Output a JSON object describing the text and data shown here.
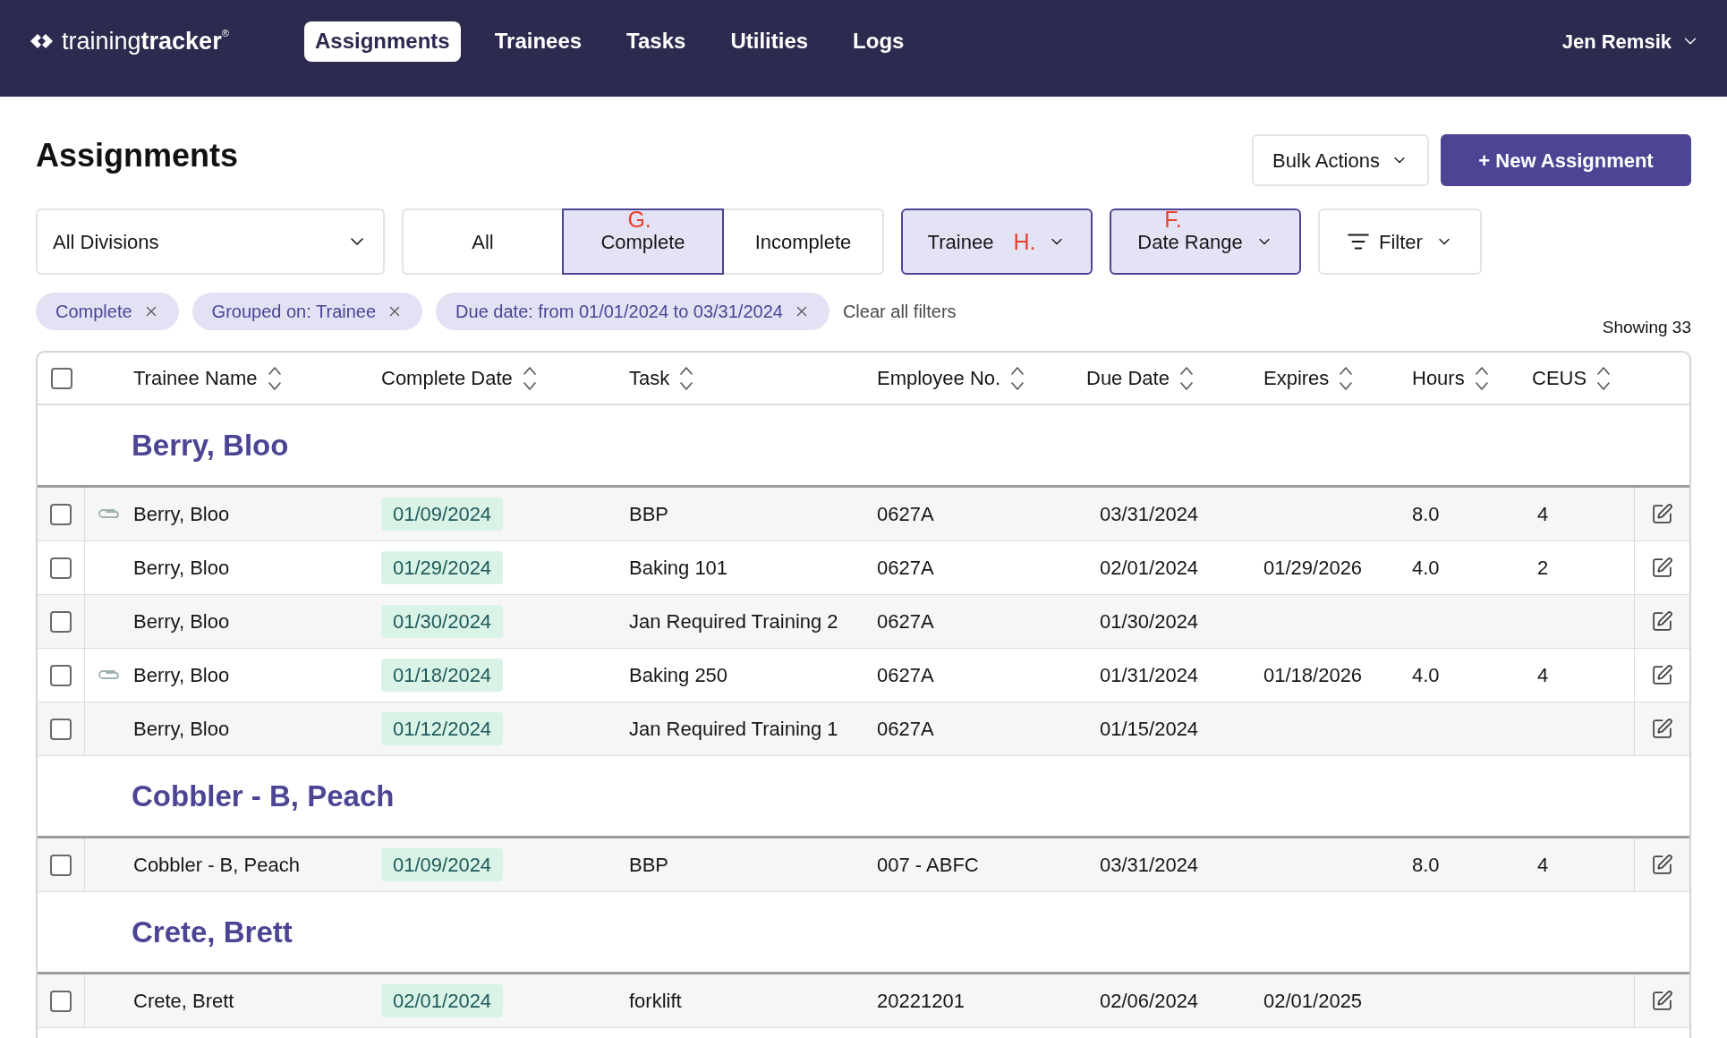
{
  "nav": {
    "logo": "training**tracker**$^{®}$",
    "tabs": [
      {
        "label": "Assignments",
        "selected": true
      },
      {
        "label": "Trainees",
        "selected": false
      },
      {
        "label": "Tasks",
        "selected": false
      },
      {
        "label": "Utilities",
        "selected": false
      },
      {
        "label": "Logs",
        "selected": false
      }
    ],
    "user": "Jen Remsik"
  },
  "header": {
    "title": "Assignments",
    "bulk_actions": "Bulk Actions",
    "new_button": "+ New Assignment"
  },
  "filters": {
    "division": {
      "value": "All Divisions"
    },
    "status_tabs": [
      {
        "label": "All",
        "selected": false
      },
      {
        "label": "Complete",
        "selected": true,
        "annotation": {
          "kind": "above",
          "text": "G."
        }
      },
      {
        "label": "Incomplete",
        "selected": false
      }
    ],
    "dropdowns": [
      {
        "kind": "dropdown",
        "label": "Trainee",
        "active": true,
        "annotation": {
          "kind": "inline",
          "text": "H."
        }
      },
      {
        "kind": "dropdown",
        "label": "Date Range",
        "active": true,
        "annotation": {
          "kind": "above",
          "text": "F."
        }
      },
      {
        "kind": "filter",
        "label": "Filter",
        "active": false
      }
    ]
  },
  "chips": [
    {
      "label": "Complete"
    },
    {
      "label": "Grouped on: Trainee"
    },
    {
      "label": "Due date: from 01/01/2024 to 03/31/2024"
    }
  ],
  "clear_filters": "Clear all filters",
  "showing": "Showing 33",
  "table": {
    "select_all": {
      "checked": false
    },
    "columns": [
      "Trainee Name",
      "Complete Date",
      "Task",
      "Employee No.",
      "Due Date",
      "Expires",
      "Hours",
      "CEUS"
    ],
    "groups": [
      {
        "name": "Berry, Bloo",
        "rows": [
          {
            "checked": false,
            "attachment": true,
            "trainee": "Berry, Bloo",
            "complete_date": "01/09/2024",
            "task": "BBP",
            "employee_no": "0627A",
            "due_date": "03/31/2024",
            "hours": "8.0",
            "ceus": "4"
          },
          {
            "checked": false,
            "attachment": false,
            "trainee": "Berry, Bloo",
            "complete_date": "01/29/2024",
            "task": "Baking 101",
            "employee_no": "0627A",
            "due_date": "02/01/2024",
            "expires": "01/29/2026",
            "hours": "4.0",
            "ceus": "2"
          },
          {
            "checked": false,
            "attachment": false,
            "trainee": "Berry, Bloo",
            "complete_date": "01/30/2024",
            "task": "Jan Required Training 2",
            "employee_no": "0627A",
            "due_date": "01/30/2024"
          },
          {
            "checked": false,
            "attachment": true,
            "trainee": "Berry, Bloo",
            "complete_date": "01/18/2024",
            "task": "Baking 250",
            "employee_no": "0627A",
            "due_date": "01/31/2024",
            "expires": "01/18/2026",
            "hours": "4.0",
            "ceus": "4"
          },
          {
            "checked": false,
            "attachment": false,
            "trainee": "Berry, Bloo",
            "complete_date": "01/12/2024",
            "task": "Jan Required Training 1",
            "employee_no": "0627A",
            "due_date": "01/15/2024"
          }
        ]
      },
      {
        "name": "Cobbler - B, Peach",
        "rows": [
          {
            "checked": false,
            "attachment": false,
            "trainee": "Cobbler - B, Peach",
            "complete_date": "01/09/2024",
            "task": "BBP",
            "employee_no": "007 - ABFC",
            "due_date": "03/31/2024",
            "hours": "8.0",
            "ceus": "4"
          }
        ]
      },
      {
        "name": "Crete, Brett",
        "rows": [
          {
            "checked": false,
            "attachment": false,
            "trainee": "Crete, Brett",
            "complete_date": "02/01/2024",
            "task": "forklift",
            "employee_no": "20221201",
            "due_date": "02/06/2024",
            "expires": "02/01/2025"
          }
        ]
      }
    ]
  }
}
